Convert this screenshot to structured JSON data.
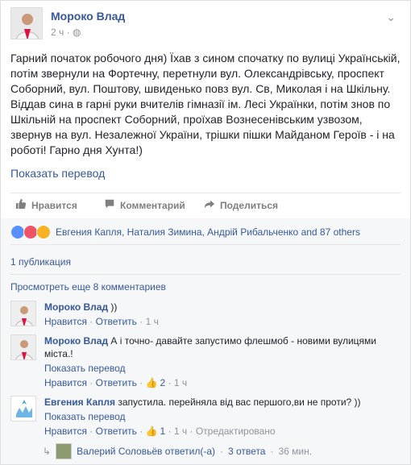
{
  "post": {
    "author": "Мороко Влад",
    "time": "2 ч",
    "text": "Гарний початок робочого дня) Їхав з сином спочатку по вулиці Українській, потім звернули на Фортечну, перетнули вул. Олександрівську, проспект Соборний, вул. Поштову, швиденько повз вул. Св, Миколая і на Шкільну. Віддав сина в гарні руки вчителів гімназії ім. Лесі Українки, потім знов по Шкільній на проспект Соборний, проїхав Вознесенівським узвозом, звернув на вул. Незалежної України, трішки пішки Майданом Героїв - і на роботі! Гарно дня Хунта!)",
    "translate_link": "Показать перевод"
  },
  "actions": {
    "like": "Нравится",
    "comment": "Комментарий",
    "share": "Поделиться"
  },
  "reactions": {
    "names": "Евгения Капля, Наталия Зимина, Андрій Рибальченко and 87 others",
    "colors": {
      "like": "#5890ff",
      "love": "#f25268",
      "wow": "#f7b125"
    }
  },
  "shares": "1 публикация",
  "more_comments": "Просмотреть еще 8 комментариев",
  "comments": [
    {
      "name": "Мороко Влад",
      "text": "))",
      "like": "Нравится",
      "reply": "Ответить",
      "time": "1 ч",
      "likes": ""
    },
    {
      "name": "Мороко Влад",
      "text": "А і точно- давайте запустимо флешмоб - новими вулицями міста.!",
      "translate": "Показать перевод",
      "like": "Нравится",
      "reply": "Ответить",
      "likes": "2",
      "time": "1 ч"
    },
    {
      "name": "Евгения Капля",
      "text": "запустила. перейняла від вас першого,ви не проти? ))",
      "translate": "Показать перевод",
      "like": "Нравится",
      "reply": "Ответить",
      "likes": "1",
      "time": "1 ч",
      "edited": "Отредактировано"
    }
  ],
  "reply_summary": {
    "text": "Валерий Соловьёв ответил(-а)",
    "count": "3 ответа",
    "time": "36 мин."
  }
}
